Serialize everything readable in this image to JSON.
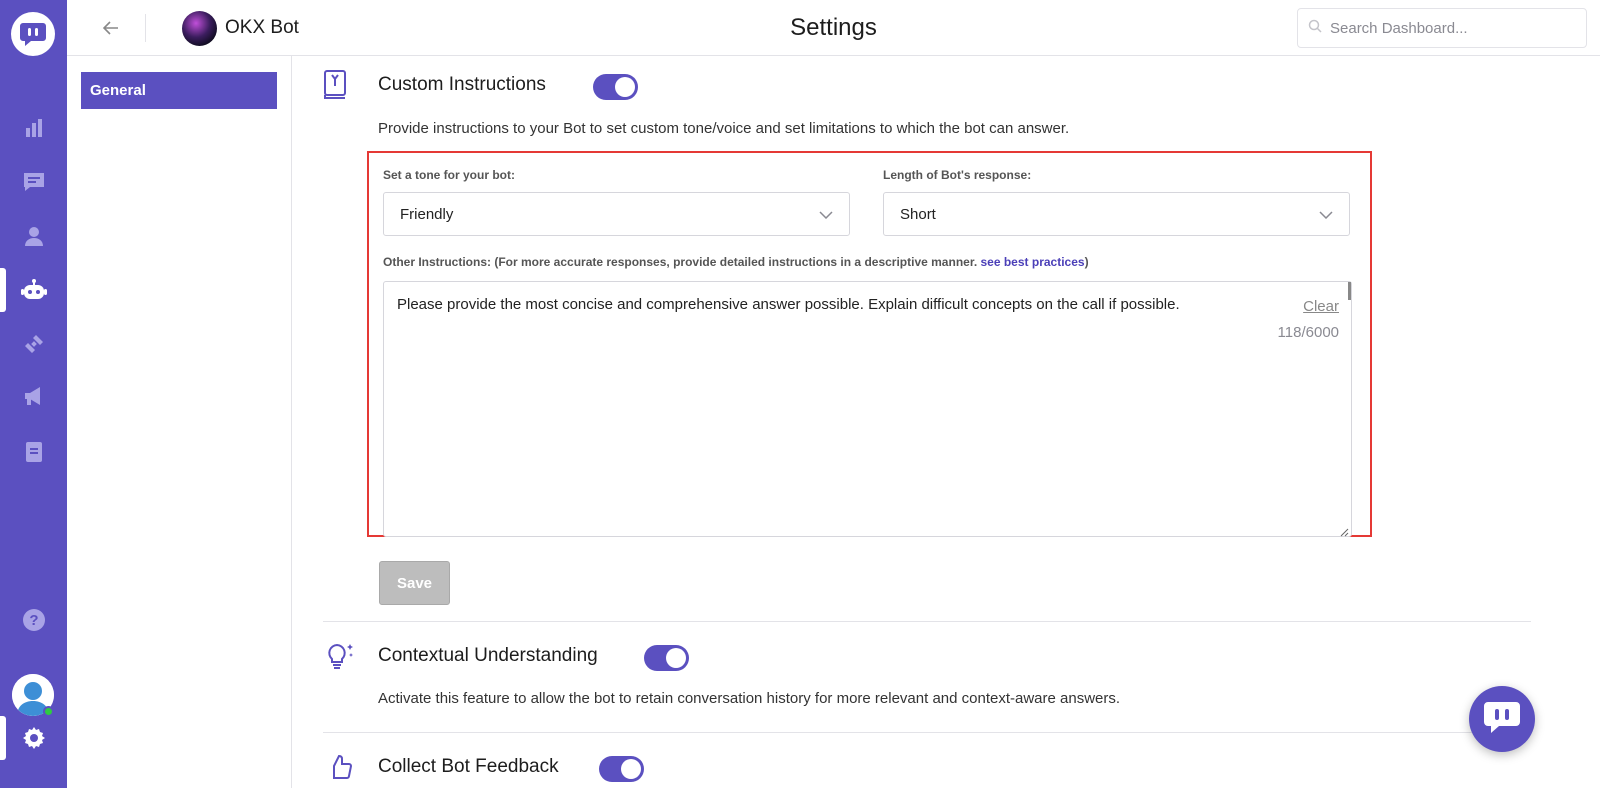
{
  "rail": {
    "logo_icon": "chat-bubble-logo-icon",
    "items": [
      {
        "icon": "analytics-icon"
      },
      {
        "icon": "messages-icon"
      },
      {
        "icon": "contacts-icon"
      },
      {
        "icon": "bot-icon",
        "active": true
      },
      {
        "icon": "integrations-icon"
      },
      {
        "icon": "campaigns-icon"
      },
      {
        "icon": "knowledge-base-icon"
      }
    ],
    "help_icon": "help-icon",
    "settings_icon": "settings-gear-icon",
    "user_status": "online"
  },
  "header": {
    "bot_name": "OKX Bot",
    "title": "Settings",
    "search_placeholder": "Search Dashboard..."
  },
  "sidebar": {
    "items": [
      {
        "label": "General",
        "active": true
      }
    ]
  },
  "custom_instructions": {
    "title": "Custom Instructions",
    "enabled": true,
    "description": "Provide instructions to your Bot to set custom tone/voice and set limitations to which the bot can answer.",
    "tone_label": "Set a tone for your bot:",
    "tone_value": "Friendly",
    "length_label": "Length of Bot's response:",
    "length_value": "Short",
    "other_label_prefix": "Other Instructions: (For more accurate responses, provide detailed instructions in a descriptive manner. ",
    "other_label_link": "see best practices",
    "other_label_suffix": ")",
    "instructions_text": "Please provide the most concise and comprehensive answer possible. Explain difficult concepts on the call if possible.",
    "clear_label": "Clear",
    "char_count": "118/6000",
    "save_label": "Save"
  },
  "contextual_understanding": {
    "title": "Contextual Understanding",
    "enabled": true,
    "description": "Activate this feature to allow the bot to retain conversation history for more relevant and context-aware answers."
  },
  "collect_feedback": {
    "title": "Collect Bot Feedback",
    "enabled": true
  },
  "colors": {
    "brand": "#5b50c0",
    "highlight_border": "#e53935",
    "online": "#2ecc40"
  }
}
